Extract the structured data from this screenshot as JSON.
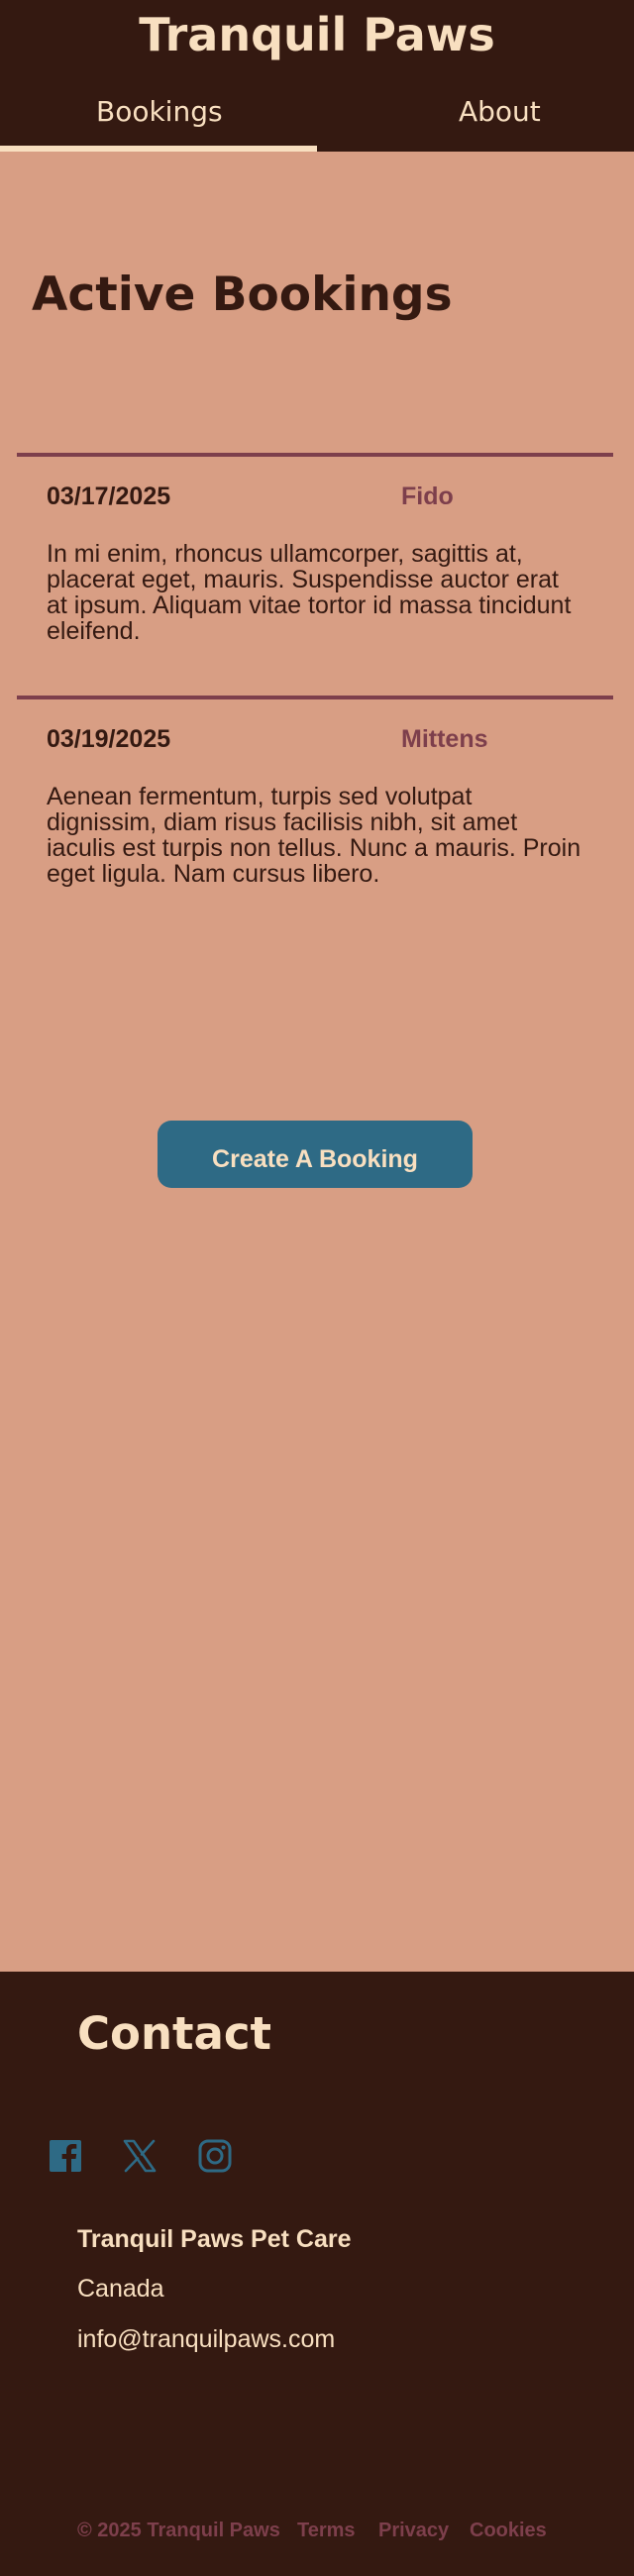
{
  "header": {
    "title": "Tranquil Paws",
    "tabs": [
      {
        "label": "Bookings",
        "active": true
      },
      {
        "label": "About",
        "active": false
      }
    ]
  },
  "main": {
    "title": "Active Bookings",
    "bookings": [
      {
        "date": "03/17/2025",
        "pet": "Fido",
        "description": "In mi enim, rhoncus ullamcorper, sagittis at, placerat eget, mauris. Suspendisse auctor erat at ipsum. Aliquam vitae tortor id massa tincidunt eleifend."
      },
      {
        "date": "03/19/2025",
        "pet": "Mittens",
        "description": "Aenean fermentum, turpis sed volutpat dignissim, diam risus facilisis nibh, sit amet iaculis est turpis non tellus. Nunc a mauris. Proin eget ligula. Nam cursus libero."
      }
    ],
    "create_button": "Create A Booking"
  },
  "footer": {
    "title": "Contact",
    "social_icons": [
      "facebook-icon",
      "x-icon",
      "instagram-icon"
    ],
    "company": "Tranquil Paws Pet Care",
    "country": "Canada",
    "email": "info@tranquilpaws.com",
    "copyright": "© 2025 Tranquil Paws",
    "links": [
      "Terms",
      "Privacy",
      "Cookies"
    ]
  },
  "colors": {
    "background": "#d89e84",
    "dark": "#341911",
    "cream": "#f8dfc0",
    "accent_plum": "#7d3f4c",
    "accent_teal": "#2e6a85"
  }
}
